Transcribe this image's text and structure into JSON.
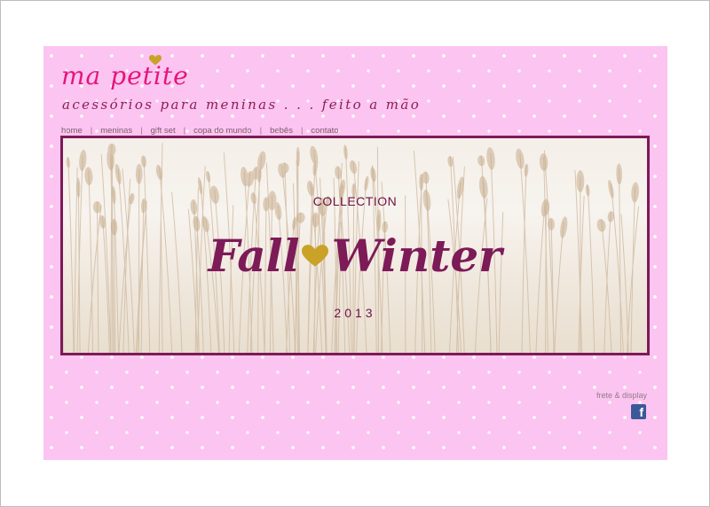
{
  "header": {
    "logo_text": "ma petite",
    "tagline": "acessórios para meninas  . . .  feito a mão"
  },
  "nav": {
    "items": [
      "home",
      "meninas",
      "gift set",
      "copa do mundo",
      "bebês",
      "contato"
    ],
    "separator": "|"
  },
  "banner": {
    "collection_label": "COLLECTION",
    "title_left": "Fall",
    "title_right": "Winter",
    "year": "2013"
  },
  "footer": {
    "frete_link": "frete & display",
    "facebook_glyph": "f",
    "facebook_icon": "facebook-icon"
  },
  "colors": {
    "background_pink": "#fcc4f0",
    "logo_pink": "#e5157a",
    "plum": "#7d1a58",
    "gold": "#c9a227",
    "facebook_blue": "#3b5998"
  }
}
